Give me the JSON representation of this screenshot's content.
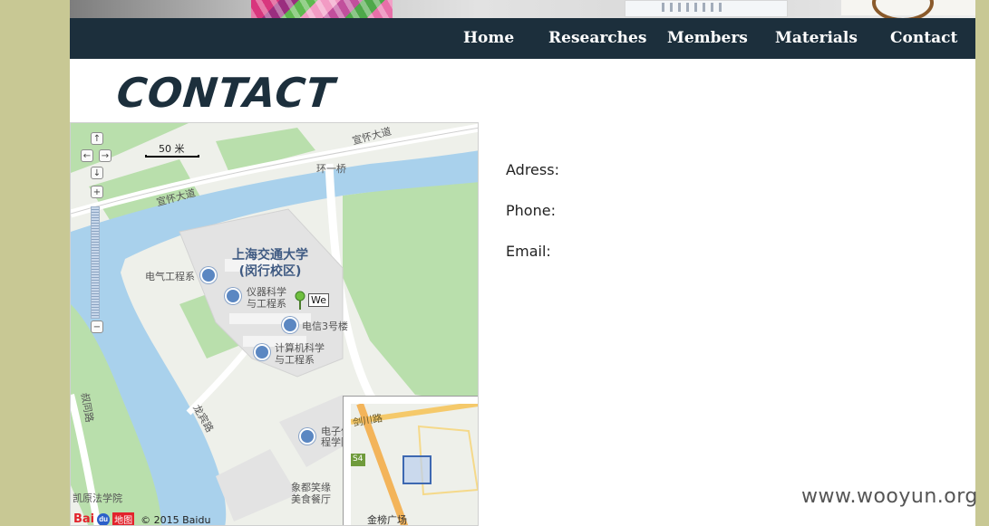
{
  "nav": {
    "items": [
      {
        "label": "Home"
      },
      {
        "label": "Researches"
      },
      {
        "label": "Members"
      },
      {
        "label": "Materials"
      },
      {
        "label": "Contact"
      }
    ]
  },
  "page": {
    "title": "CONTACT"
  },
  "map": {
    "scale_label": "50 米",
    "marker_label": "We",
    "campus_label_line1": "上海交通大学",
    "campus_label_line2": "(闵行校区)",
    "roads": [
      "宣怀大道",
      "宣怀大道",
      "环一桥",
      "龙宾路",
      "叔同路",
      "剑川路"
    ],
    "places": [
      "电气工程系",
      "仪器科学",
      "与工程系",
      "电信3号楼",
      "计算机科学",
      "与工程系",
      "电子信",
      "程学院",
      "象都笑缘",
      "美食餐厅",
      "凯原法学院",
      "金榜广场"
    ],
    "overview_road_badge": "S4",
    "zoom_buttons": {
      "up": "↑",
      "left": "←",
      "right": "→",
      "down": "↓",
      "zoom_in": "+",
      "zoom_out": "−"
    },
    "logo_text": "Bai",
    "logo_paw": "du",
    "logo_suffix": "地图",
    "copyright": "© 2015 Baidu"
  },
  "contact": {
    "address_label": "Adress:",
    "phone_label": "Phone:",
    "email_label": "Email:"
  },
  "watermark": "www.wooyun.org",
  "colors": {
    "nav_bg": "#1c2f3c",
    "side_bg": "#c8c894",
    "water": "#a9d1ec",
    "green": "#b9dfac"
  }
}
